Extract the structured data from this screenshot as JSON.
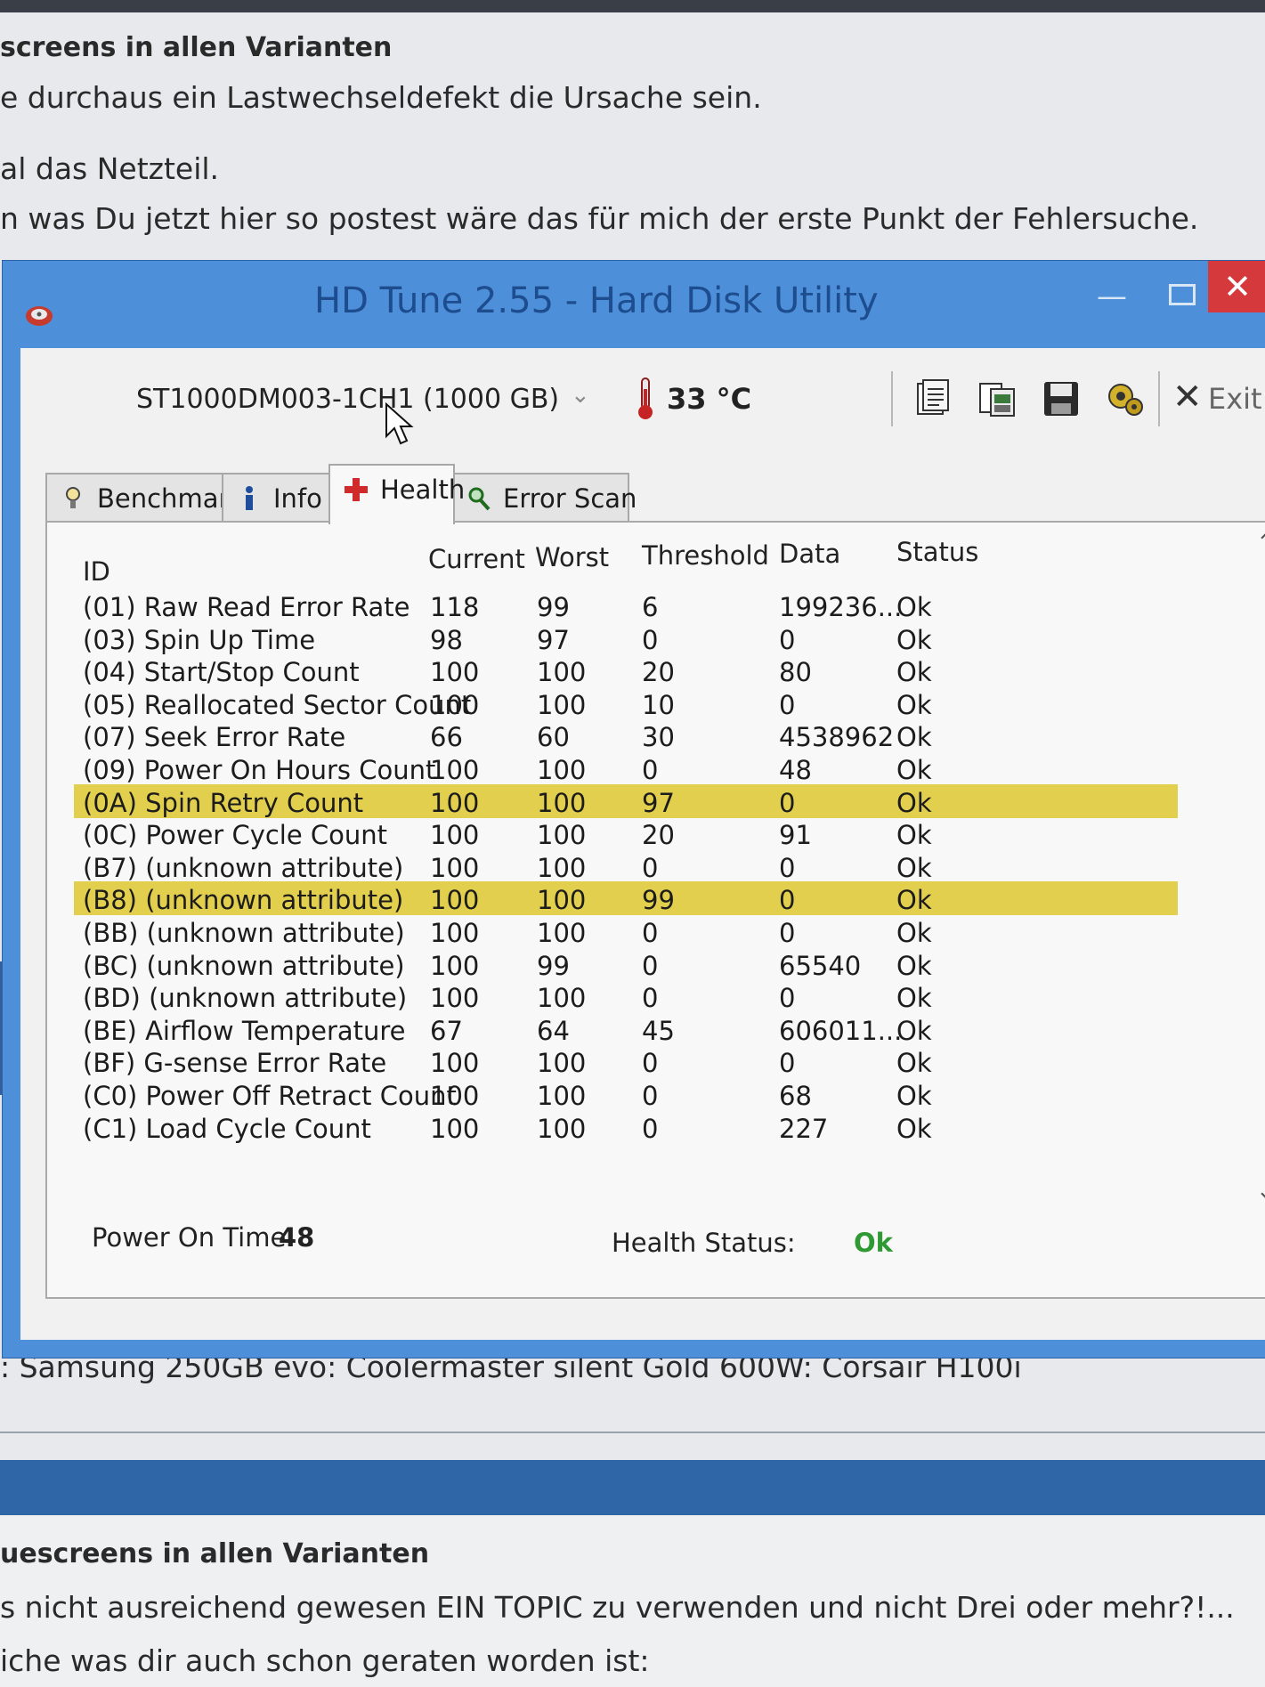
{
  "forum": {
    "top_heading": "screens in allen Varianten",
    "line1": "e durchaus ein Lastwechseldefekt die Ursache sein.",
    "line2": "al das Netzteil.",
    "line3": "n was Du jetzt hier so postest wäre das für mich der erste Punkt der Fehlersuche.",
    "signature": ": Samsung 250GB evo: Coolermaster silent Gold 600W: Corsair H100i",
    "bottom_heading": "uescreens in allen Varianten",
    "bottom_line1": "s nicht ausreichend gewesen EIN TOPIC zu verwenden und nicht Drei oder mehr?!...",
    "bottom_line2": "iche was dir auch schon geraten worden ist:"
  },
  "window": {
    "title": "HD Tune 2.55 - Hard Disk Utility",
    "drive": "ST1000DM003-1CH1 (1000 GB)",
    "temperature": "33 °C",
    "exit_label": "Exit",
    "toolbar_icons": [
      "copy-text-icon",
      "copy-screenshot-icon",
      "save-icon",
      "options-icon"
    ],
    "tabs": [
      {
        "label": "Benchmark",
        "icon": "benchmark-icon"
      },
      {
        "label": "Info",
        "icon": "info-icon"
      },
      {
        "label": "Health",
        "icon": "health-cross-icon",
        "active": true
      },
      {
        "label": "Error Scan",
        "icon": "magnifier-icon"
      }
    ],
    "columns": [
      "ID",
      "Current",
      "Worst",
      "Threshold",
      "Data",
      "Status"
    ],
    "rows": [
      {
        "id": "(01) Raw Read Error Rate",
        "current": "118",
        "worst": "99",
        "threshold": "6",
        "data": "199236...",
        "status": "Ok",
        "warn": false
      },
      {
        "id": "(03) Spin Up Time",
        "current": "98",
        "worst": "97",
        "threshold": "0",
        "data": "0",
        "status": "Ok",
        "warn": false
      },
      {
        "id": "(04) Start/Stop Count",
        "current": "100",
        "worst": "100",
        "threshold": "20",
        "data": "80",
        "status": "Ok",
        "warn": false
      },
      {
        "id": "(05) Reallocated Sector Count",
        "current": "100",
        "worst": "100",
        "threshold": "10",
        "data": "0",
        "status": "Ok",
        "warn": false
      },
      {
        "id": "(07) Seek Error Rate",
        "current": "66",
        "worst": "60",
        "threshold": "30",
        "data": "4538962",
        "status": "Ok",
        "warn": false
      },
      {
        "id": "(09) Power On Hours Count",
        "current": "100",
        "worst": "100",
        "threshold": "0",
        "data": "48",
        "status": "Ok",
        "warn": false
      },
      {
        "id": "(0A) Spin Retry Count",
        "current": "100",
        "worst": "100",
        "threshold": "97",
        "data": "0",
        "status": "Ok",
        "warn": true
      },
      {
        "id": "(0C) Power Cycle Count",
        "current": "100",
        "worst": "100",
        "threshold": "20",
        "data": "91",
        "status": "Ok",
        "warn": false
      },
      {
        "id": "(B7) (unknown attribute)",
        "current": "100",
        "worst": "100",
        "threshold": "0",
        "data": "0",
        "status": "Ok",
        "warn": false
      },
      {
        "id": "(B8) (unknown attribute)",
        "current": "100",
        "worst": "100",
        "threshold": "99",
        "data": "0",
        "status": "Ok",
        "warn": true
      },
      {
        "id": "(BB) (unknown attribute)",
        "current": "100",
        "worst": "100",
        "threshold": "0",
        "data": "0",
        "status": "Ok",
        "warn": false
      },
      {
        "id": "(BC) (unknown attribute)",
        "current": "100",
        "worst": "99",
        "threshold": "0",
        "data": "65540",
        "status": "Ok",
        "warn": false
      },
      {
        "id": "(BD) (unknown attribute)",
        "current": "100",
        "worst": "100",
        "threshold": "0",
        "data": "0",
        "status": "Ok",
        "warn": false
      },
      {
        "id": "(BE) Airflow Temperature",
        "current": "67",
        "worst": "64",
        "threshold": "45",
        "data": "606011...",
        "status": "Ok",
        "warn": false
      },
      {
        "id": "(BF) G-sense Error Rate",
        "current": "100",
        "worst": "100",
        "threshold": "0",
        "data": "0",
        "status": "Ok",
        "warn": false
      },
      {
        "id": "(C0) Power Off Retract Count",
        "current": "100",
        "worst": "100",
        "threshold": "0",
        "data": "68",
        "status": "Ok",
        "warn": false
      },
      {
        "id": "(C1) Load Cycle Count",
        "current": "100",
        "worst": "100",
        "threshold": "0",
        "data": "227",
        "status": "Ok",
        "warn": false
      }
    ],
    "footer": {
      "power_on_label": "Power On Time:",
      "power_on_value": "48",
      "health_label": "Health Status:",
      "health_value": "Ok"
    }
  },
  "colors": {
    "title_bar": "#4d8fd8",
    "close_button": "#d6393b",
    "warning_row": "#e3cf4e",
    "status_ok": "#2f9a34"
  }
}
